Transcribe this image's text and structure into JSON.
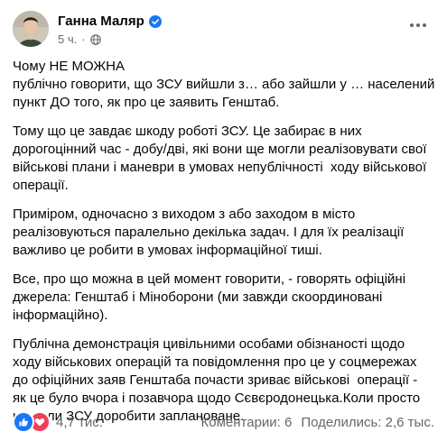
{
  "post": {
    "author": "Ганна Маляр",
    "time": "5 ч.",
    "separator": "·",
    "paragraphs": [
      {
        "lines": [
          "Чому НЕ МОЖНА",
          "публічно говорити, що ЗСУ вийшли з… або зайшли у … населений",
          "пункт ДО того, як про це заявить Генштаб."
        ]
      },
      {
        "lines": [
          "Тому що це завдає шкоду роботі ЗСУ. Це забирає в них",
          "дорогоцінний час - добу/дві, які вони ще могли реалізовувати свої",
          "військові плани і маневри в умовах непублічності  ходу військової",
          "операції."
        ]
      },
      {
        "lines": [
          "Приміром, одночасно з виходом з або заходом в місто",
          "реалізовуються паралельно декілька задач. І для їх реалізації",
          "важливо це робити в умовах інформаційної тиші."
        ]
      },
      {
        "lines": [
          "Все, про що можна в цей момент говорити, - говорять офіційні",
          "джерела: Генштаб і Міноборони (ми завжди скоординовані",
          "інформаційно)."
        ]
      },
      {
        "lines": [
          "Публічна демонстрація цивільними особами обізнаності щодо",
          "ходу військових операцій та повідомлення про це у соцмережах",
          "до офіційних заяв Генштаба почасти зриває військові  операції -",
          "як це було вчора і позавчора щодо Сєвєродонецька.Коли просто",
          "не дали ЗСУ доробити заплановане."
        ]
      }
    ]
  },
  "footer": {
    "reactions_count": "4,7 тис.",
    "comments": "Коментарии: 6",
    "shares": "Поделились: 2,6 тыс."
  },
  "icons": {
    "verified": "verified-badge-icon",
    "privacy": "globe-icon",
    "more": "more-options-icon",
    "like": "like-reaction-icon",
    "love": "love-reaction-icon"
  },
  "colors": {
    "accent": "#1877f2",
    "heart": "#f33e58",
    "secondary_text": "#65676b"
  }
}
